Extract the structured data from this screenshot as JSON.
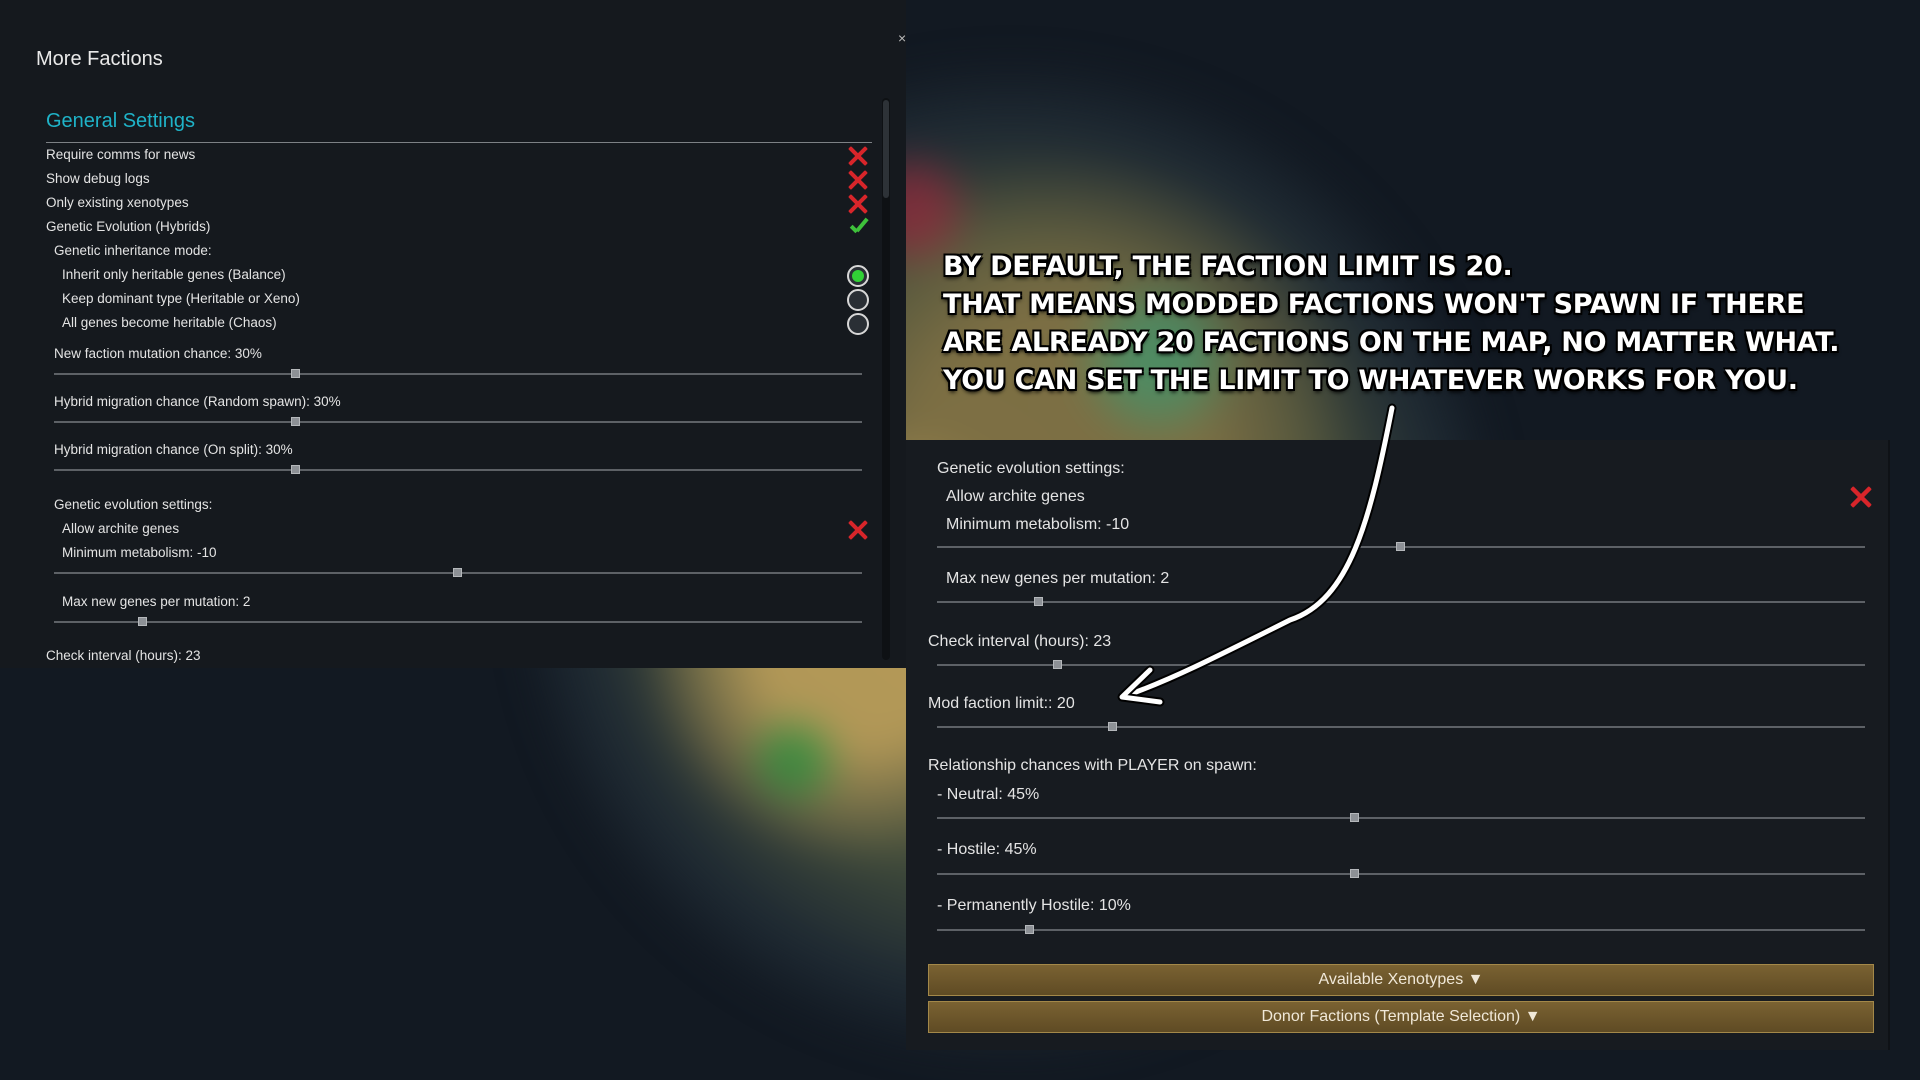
{
  "window": {
    "title": "More Factions",
    "close_glyph": "×"
  },
  "left_settings": {
    "section_title": "General Settings",
    "toggles": [
      {
        "label": "Require comms for news",
        "state": "off"
      },
      {
        "label": "Show debug logs",
        "state": "off"
      },
      {
        "label": "Only existing xenotypes",
        "state": "off"
      },
      {
        "label": "Genetic Evolution (Hybrids)",
        "state": "on"
      }
    ],
    "inheritance_label": "Genetic inheritance mode:",
    "inheritance_options": [
      {
        "label": "Inherit only heritable genes (Balance)",
        "selected": true
      },
      {
        "label": "Keep dominant type (Heritable or Xeno)",
        "selected": false
      },
      {
        "label": "All genes become heritable (Chaos)",
        "selected": false
      }
    ],
    "sliders": [
      {
        "label": "New faction mutation chance: 30%",
        "value": 0.3
      },
      {
        "label": "Hybrid migration chance (Random spawn): 30%",
        "value": 0.3
      },
      {
        "label": "Hybrid migration chance (On split): 30%",
        "value": 0.3
      }
    ],
    "evolution": {
      "heading": "Genetic evolution settings:",
      "archite_label": "Allow archite genes",
      "archite_state": "off",
      "metabolism": {
        "label": "Minimum metabolism: -10",
        "value": 0.5
      },
      "max_genes": {
        "label": "Max new genes per mutation: 2",
        "value": 0.11
      }
    },
    "check_interval": "Check interval (hours): 23"
  },
  "caption": {
    "lines": [
      "By default, the faction limit is 20.",
      "That means modded factions won't spawn if there",
      "are already 20 factions on the map, no matter what.",
      "You can set the limit to whatever works for you."
    ]
  },
  "right_settings": {
    "evolution_heading": "Genetic evolution settings:",
    "archite_label": "Allow archite genes",
    "archite_state": "off",
    "metabolism": {
      "label": "Minimum metabolism: -10",
      "value": 0.5
    },
    "max_genes": {
      "label": "Max new genes per mutation: 2",
      "value": 0.11
    },
    "check_interval": {
      "label": "Check interval (hours): 23",
      "value": 0.13
    },
    "faction_limit": {
      "label": "Mod faction limit:: 20",
      "value": 0.19
    },
    "relationship_heading": "Relationship chances with PLAYER on spawn:",
    "relationships": [
      {
        "label": "- Neutral: 45%",
        "value": 0.45
      },
      {
        "label": "- Hostile: 45%",
        "value": 0.45
      },
      {
        "label": "- Permanently Hostile: 10%",
        "value": 0.1
      }
    ],
    "buttons": {
      "xenotypes": "Available Xenotypes ▼",
      "donor": "Donor Factions (Template Selection) ▼"
    }
  },
  "colors": {
    "accent_title": "#1fb3c8",
    "off_x": "#d8252a",
    "on_check": "#3ec13b",
    "radio_on": "#31d136",
    "button_brown": "#6b5529"
  }
}
